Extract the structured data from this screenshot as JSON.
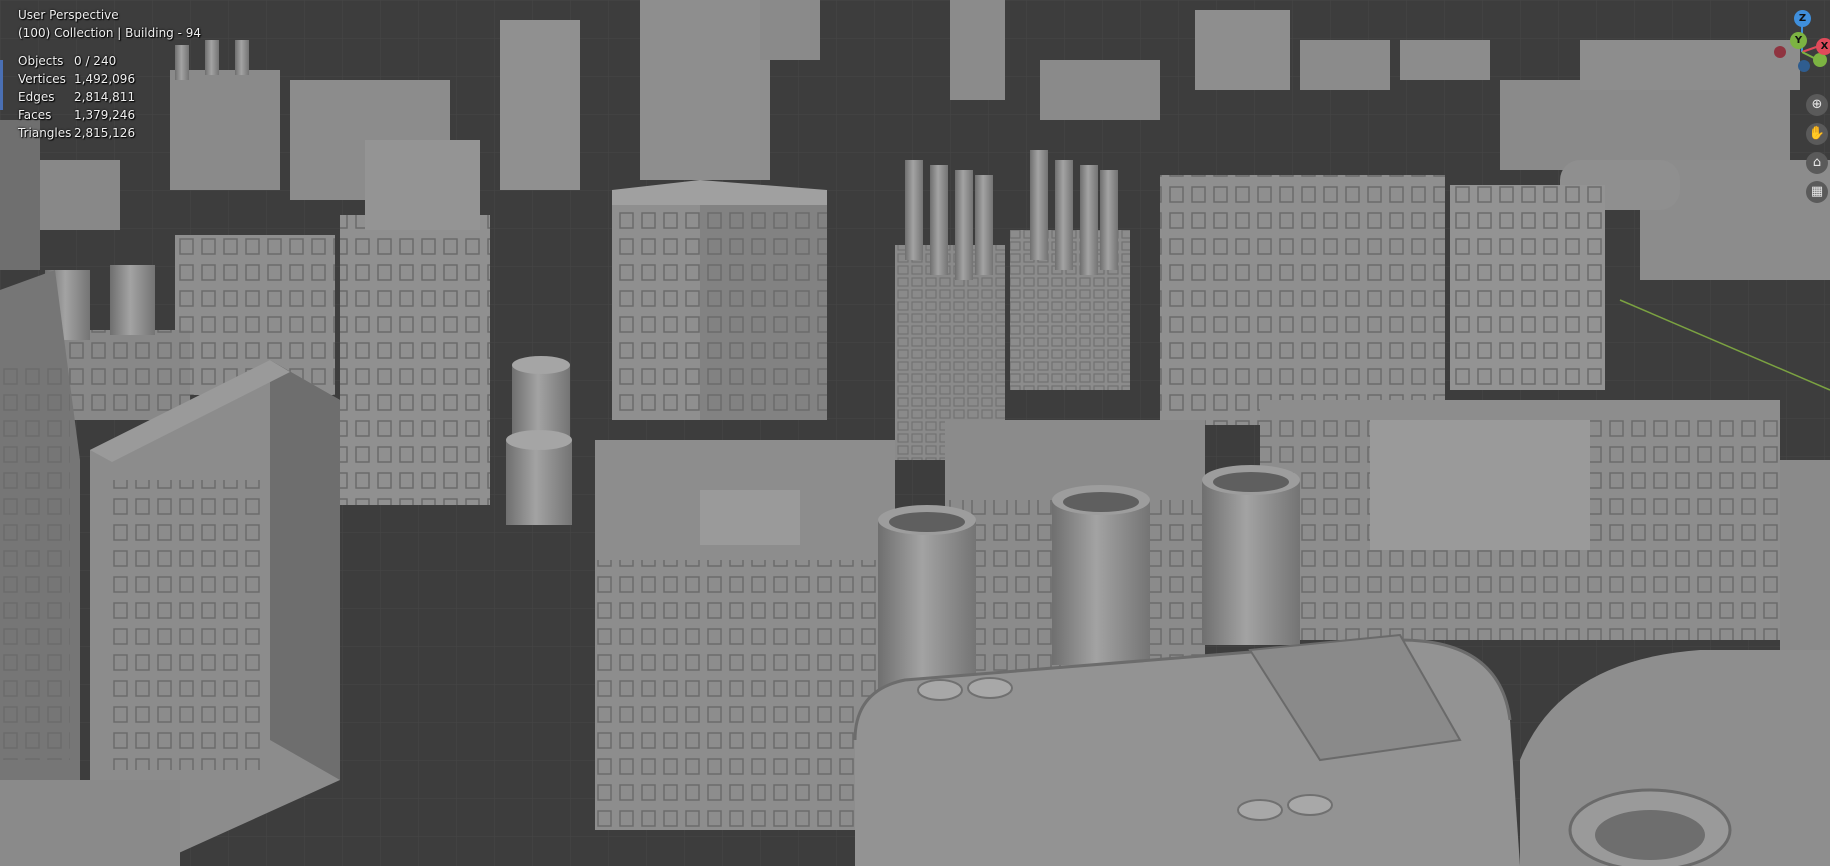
{
  "header": {
    "view_name": "User Perspective",
    "collection_info": "(100) Collection | Building - 94"
  },
  "statistics": [
    {
      "label": "Objects",
      "value": "0 / 240"
    },
    {
      "label": "Vertices",
      "value": "1,492,096"
    },
    {
      "label": "Edges",
      "value": "2,814,811"
    },
    {
      "label": "Faces",
      "value": "1,379,246"
    },
    {
      "label": "Triangles",
      "value": "2,815,126"
    }
  ],
  "gizmo": {
    "z_label": "Z",
    "y_label": "Y",
    "x_label": "X",
    "colors": {
      "x": "#e04a5a",
      "y": "#7cb342",
      "z": "#3f8fdc"
    }
  },
  "tools": [
    {
      "icon": "zoom-icon",
      "glyph": "⊕"
    },
    {
      "icon": "hand-icon",
      "glyph": "✋"
    },
    {
      "icon": "camera-icon",
      "glyph": "⌂"
    },
    {
      "icon": "grid-icon",
      "glyph": "▦"
    }
  ],
  "colors": {
    "viewport_background": "#3d3d3d",
    "grid_line": "#474747",
    "model_fill": "#8f8f8f",
    "model_shadow": "#6a6a6a"
  }
}
